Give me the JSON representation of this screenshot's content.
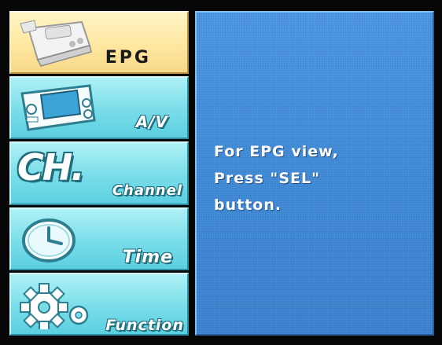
{
  "menu": {
    "items": [
      {
        "label": "EPG",
        "icon": "tv-remote-icon",
        "selected": true
      },
      {
        "label": "A/V",
        "icon": "handheld-tv-icon",
        "selected": false
      },
      {
        "label": "Channel",
        "icon": "ch-icon",
        "icon_text": "CH.",
        "selected": false
      },
      {
        "label": "Time",
        "icon": "clock-icon",
        "selected": false
      },
      {
        "label": "Function",
        "icon": "gears-icon",
        "selected": false
      }
    ]
  },
  "panel": {
    "lines": [
      "For EPG view,",
      "Press \"SEL\"",
      "button."
    ]
  },
  "colors": {
    "selected_bg": "#ffe7a0",
    "menu_bg": "#79dde9",
    "panel_bg": "#3f8ad7",
    "text": "#ffffff"
  }
}
